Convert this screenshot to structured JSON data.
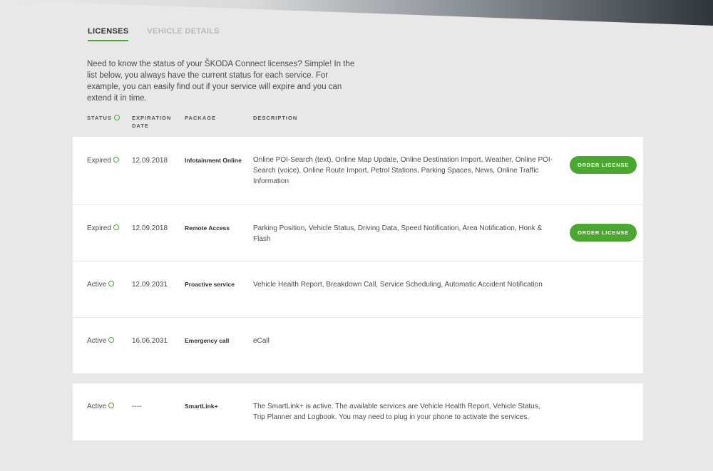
{
  "tabs": [
    {
      "label": "LICENSES",
      "active": true
    },
    {
      "label": "VEHICLE DETAILS",
      "active": false
    }
  ],
  "intro": "Need to know the status of your ŠKODA Connect licenses? Simple! In the list below, you always have the current status for each service. For example, you can easily find out if your service will expire and you can extend it in time.",
  "columns": {
    "status": "STATUS",
    "expiration_line1": "EXPIRATION",
    "expiration_line2": "DATE",
    "package": "PACKAGE",
    "description": "DESCRIPTION"
  },
  "licenses": [
    {
      "status": "Expired",
      "date": "12.09.2018",
      "package": "Infotainment Online",
      "description": "Online POI-Search (text), Online Map Update, Online Destination Import, Weather, Online POI-Search (voice), Online Route Import, Petrol Stations, Parking Spaces, News, Online Traffic Information",
      "action": "ORDER LICENSE"
    },
    {
      "status": "Expired",
      "date": "12.09.2018",
      "package": "Remote Access",
      "description": "Parking Position, Vehicle Status, Driving Data, Speed Notification, Area Notification, Honk & Flash",
      "action": "ORDER LICENSE"
    },
    {
      "status": "Active",
      "date": "12.09.2031",
      "package": "Proactive service",
      "description": "Vehicle Health Report, Breakdown Call, Service Scheduling, Automatic Accident Notification"
    },
    {
      "status": "Active",
      "date": "16.06.2031",
      "package": "Emergency call",
      "description": "eCall"
    }
  ],
  "smartlink": {
    "status": "Active",
    "date": "----",
    "package": "SmartLink+",
    "description": "The SmartLink+ is active. The available services are Vehicle Health Report, Vehicle Status, Trip Planner and Logbook. You may need to plug in your phone to activate the services."
  },
  "colors": {
    "accent": "#4ba82e",
    "background": "#e8e8e8"
  }
}
